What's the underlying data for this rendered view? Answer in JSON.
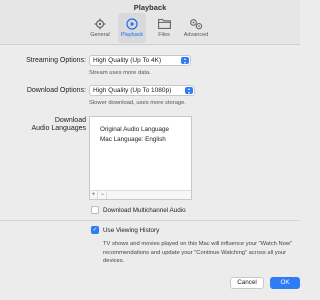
{
  "window": {
    "title": "Playback"
  },
  "tabs": [
    {
      "label": "General",
      "icon": "gear-icon"
    },
    {
      "label": "Playback",
      "icon": "play-icon",
      "selected": true
    },
    {
      "label": "Files",
      "icon": "folder-icon"
    },
    {
      "label": "Advanced",
      "icon": "gears-icon"
    }
  ],
  "streaming": {
    "label": "Streaming Options:",
    "value": "High Quality (Up To 4K)",
    "hint": "Stream uses more data."
  },
  "download": {
    "label": "Download Options:",
    "value": "High Quality (Up To 1080p)",
    "hint": "Slower download, uses more storage."
  },
  "languages": {
    "label_line1": "Download",
    "label_line2": "Audio Languages",
    "items": [
      "Original Audio Language",
      "Mac Language: English"
    ],
    "add": "+",
    "remove": "−"
  },
  "multichannel": {
    "label": "Download Multichannel Audio",
    "checked": false
  },
  "history": {
    "label": "Use Viewing History",
    "checked": true,
    "description": "TV shows and movies played on this Mac will influence your \"Watch Now\" recommendations and update your \"Continue Watching\" across all your devices."
  },
  "buttons": {
    "cancel": "Cancel",
    "ok": "OK"
  },
  "colors": {
    "accent": "#2e7cf6"
  }
}
